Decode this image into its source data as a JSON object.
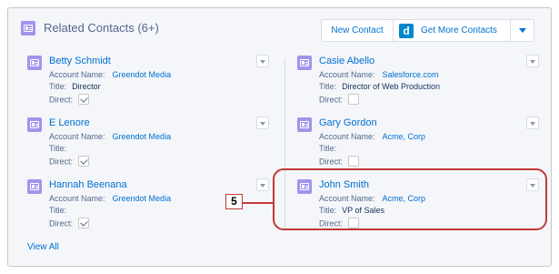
{
  "header": {
    "title": "Related Contacts (6+)",
    "new_contact_label": "New Contact",
    "get_more_label": "Get More Contacts",
    "d_logo": "d"
  },
  "labels": {
    "account": "Account Name:",
    "title": "Title:",
    "direct": "Direct:"
  },
  "contacts": [
    {
      "name": "Betty Schmidt",
      "account": "Greendot Media",
      "title": "Director",
      "direct": true
    },
    {
      "name": "Casie Abello",
      "account": "Salesforce.com",
      "title": "Director of Web Production",
      "direct": false
    },
    {
      "name": "E Lenore",
      "account": "Greendot Media",
      "title": "",
      "direct": true
    },
    {
      "name": "Gary Gordon",
      "account": "Acme, Corp",
      "title": "",
      "direct": false
    },
    {
      "name": "Hannah Beenana",
      "account": "Greendot Media",
      "title": "",
      "direct": true
    },
    {
      "name": "John Smith",
      "account": "Acme, Corp",
      "title": "VP of Sales",
      "direct": false
    }
  ],
  "view_all": "View All",
  "callout": {
    "number": "5"
  },
  "colors": {
    "accent": "#0070d2",
    "icon": "#a094ed",
    "callout": "#c23934"
  }
}
